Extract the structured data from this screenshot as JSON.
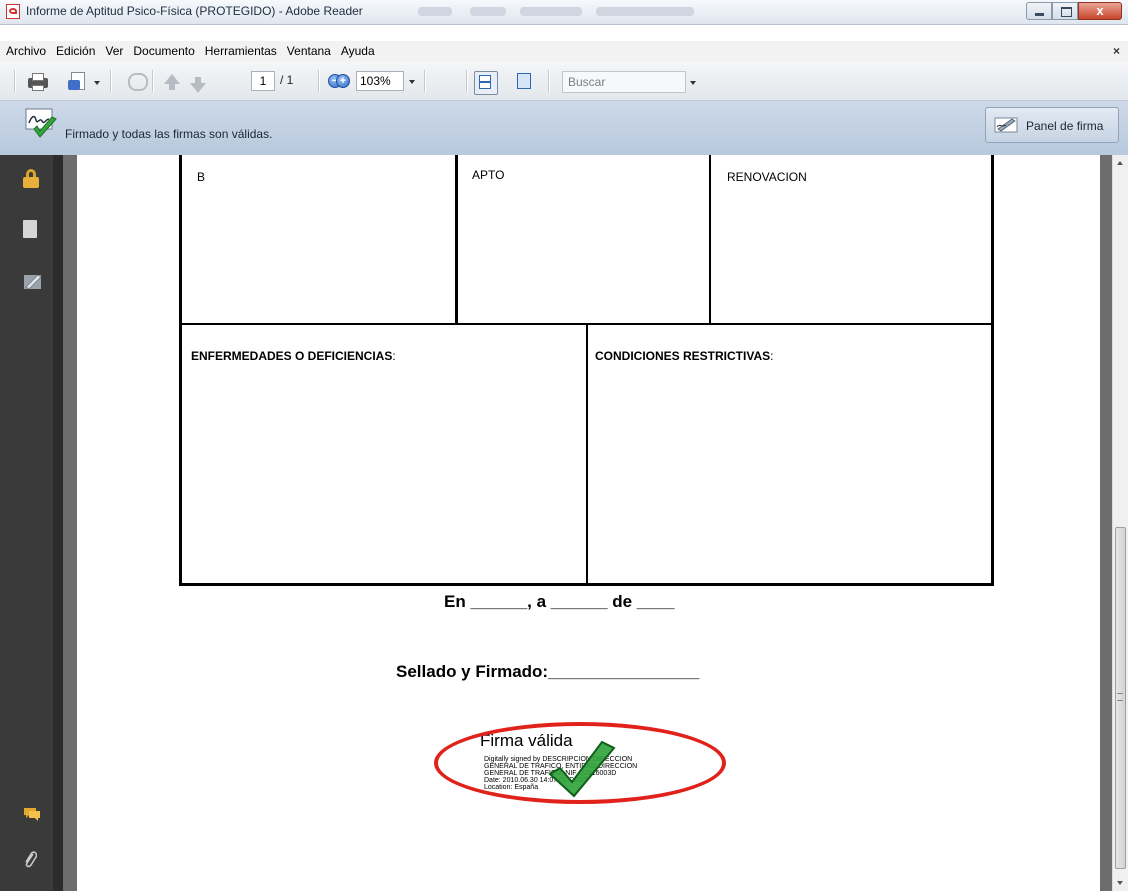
{
  "window": {
    "title": "Informe de Aptitud Psico-Física (PROTEGIDO) - Adobe Reader",
    "close_glyph": "x"
  },
  "menu": {
    "items": [
      "Archivo",
      "Edición",
      "Ver",
      "Documento",
      "Herramientas",
      "Ventana",
      "Ayuda"
    ],
    "close_glyph": "×"
  },
  "toolbar": {
    "page_current": "1",
    "page_total": "/ 1",
    "zoom_out_glyph": "−",
    "zoom_in_glyph": "+",
    "zoom": "103%",
    "search_placeholder": "Buscar"
  },
  "signature_bar": {
    "message": "Firmado y todas las firmas son válidas.",
    "panel_button": "Panel de firma"
  },
  "form": {
    "row1": [
      "B",
      "APTO",
      "RENOVACION"
    ],
    "enfermedades_label": "ENFERMEDADES O DEFICIENCIAS",
    "condiciones_label": "CONDICIONES RESTRICTIVAS",
    "label_suffix": ":"
  },
  "footer": {
    "place_date_line": "En ______, a ______ de ____",
    "stamp_line": "Sellado y Firmado:________________"
  },
  "signature": {
    "status": "Firma válida",
    "details": [
      "Digitally signed by DESCRIPCION DIRECCION",
      "GENERAL DE TRAFICO, ENTIDAD DIRECCION",
      "GENERAL DE TRAFICO, NIF Q2816003D",
      "Date: 2010.06.30 14:07:01 CEST",
      "Location: España"
    ]
  },
  "icons": {
    "lock": "lock-icon",
    "pages": "pages-icon",
    "signatures": "signature-icon",
    "comments": "comment-icon",
    "attachments": "paperclip-icon",
    "checkmark": "checkmark-icon"
  },
  "colors": {
    "highlight_ellipse": "#e0221b",
    "checkmark": "#2ea33a",
    "signature_bar": "#c4d3e5"
  }
}
